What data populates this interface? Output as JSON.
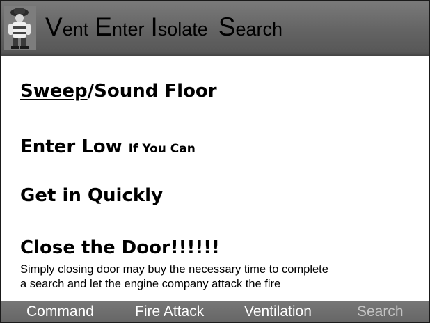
{
  "title": {
    "v": "V",
    "vent_rest": "ent",
    "e": "E",
    "enter_rest": "nter",
    "i": "I",
    "isolate_rest": "solate",
    "s": "S",
    "search_rest": "earch"
  },
  "logo_icon": "firefighter-icon",
  "points": {
    "sweep": "Sweep",
    "sound_floor": "/Sound  Floor",
    "enter_low": "Enter Low",
    "if_you_can": "If You Can",
    "get_in_quickly": "Get in Quickly",
    "close_the_door": "Close the Door!!!!!!"
  },
  "note": {
    "line1": "Simply closing door may buy the necessary time to complete",
    "line2": "a search and let the engine company attack the fire"
  },
  "nav": {
    "command": "Command",
    "fire_attack": "Fire Attack",
    "ventilation": "Ventilation",
    "search": "Search"
  },
  "colors": {
    "title_bar": "#666666",
    "nav_bar": "#6e6e6e",
    "nav_text": "#ffffff",
    "nav_text_current": "#c4c4c4"
  }
}
